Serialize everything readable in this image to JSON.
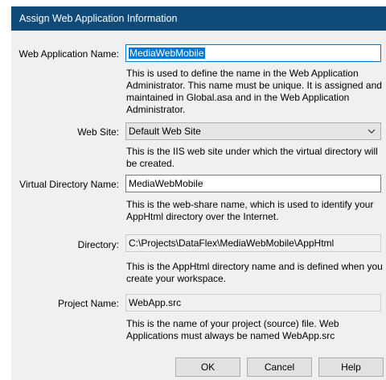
{
  "window": {
    "title": "Assign Web Application Information"
  },
  "app_name": {
    "label": "Web Application Name:",
    "value": "MediaWebMobile",
    "description": "This is used to define the name in the Web Application Administrator. This name must be unique. It is assigned and maintained in Global.asa and in the Web Application Administrator."
  },
  "web_site": {
    "label": "Web Site:",
    "value": "Default Web Site",
    "icon": "chevron-down-icon",
    "description": "This is the IIS web site under which the virtual directory will be created."
  },
  "virtual_dir": {
    "label": "Virtual Directory Name:",
    "value": "MediaWebMobile",
    "description": "This is the web-share name, which is used to identify your AppHtml directory over the Internet."
  },
  "directory": {
    "label": "Directory:",
    "value": "C:\\Projects\\DataFlex\\MediaWebMobile\\AppHtml",
    "description": "This is the AppHtml directory name and is defined when you create your workspace."
  },
  "project": {
    "label": "Project Name:",
    "value": "WebApp.src",
    "description": "This is the name of your project (source) file. Web Applications must always be named WebApp.src"
  },
  "buttons": {
    "ok": "OK",
    "cancel": "Cancel",
    "help": "Help"
  },
  "colors": {
    "titlebar": "#0f4a78",
    "dialog_bg": "#f0f0f0",
    "selection": "#0078d7"
  }
}
